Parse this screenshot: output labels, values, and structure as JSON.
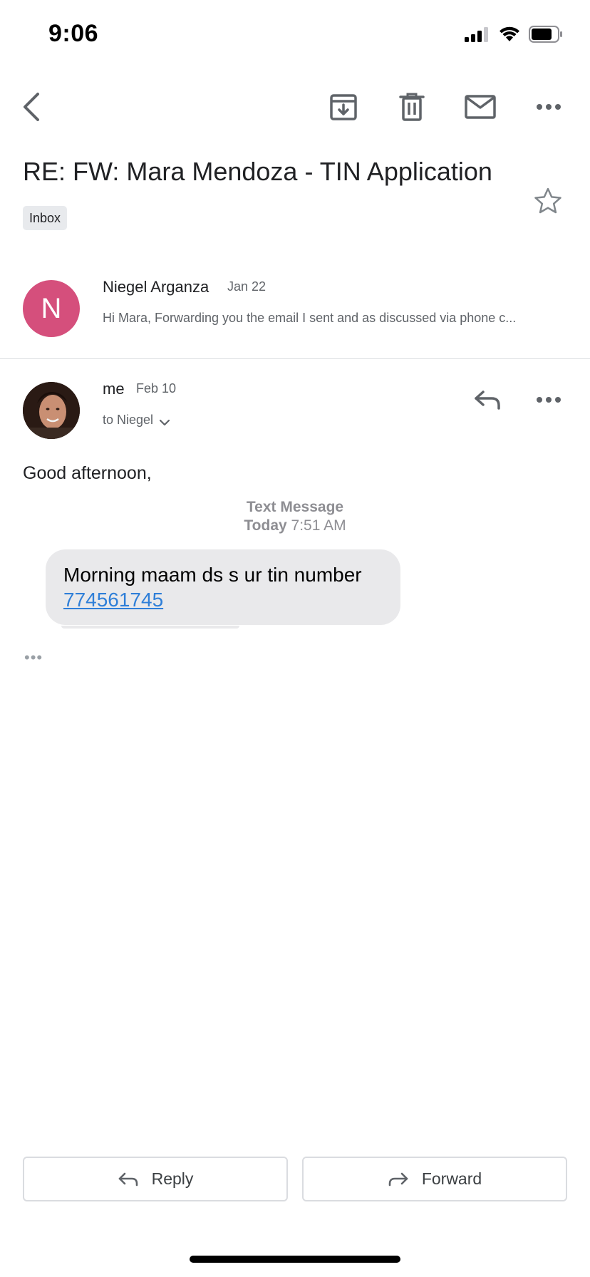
{
  "status_bar": {
    "time": "9:06"
  },
  "toolbar": {
    "back_icon": "chevron-left-icon",
    "archive_icon": "archive-icon",
    "delete_icon": "trash-icon",
    "mark_unread_icon": "mail-icon",
    "more_icon": "more-horizontal-icon"
  },
  "email": {
    "subject": "RE: FW: Mara Mendoza - TIN Application",
    "label": "Inbox"
  },
  "messages": [
    {
      "avatar_letter": "N",
      "avatar_color": "#d54f7c",
      "sender": "Niegel Arganza",
      "date": "Jan 22",
      "snippet": "Hi Mara, Forwarding you the email I sent and as discussed via phone c..."
    },
    {
      "sender": "me",
      "date": "Feb 10",
      "recipient": "to Niegel",
      "greeting": "Good afternoon,",
      "sms": {
        "header_line1": "Text Message",
        "header_day": "Today",
        "header_time": "7:51 AM",
        "text": "Morning maam ds s ur tin number",
        "number": "774561745"
      },
      "trimmed_content": "•••"
    }
  ],
  "footer": {
    "reply_label": "Reply",
    "forward_label": "Forward"
  },
  "colors": {
    "link": "#2f7fd8",
    "bubble": "#e9e9eb",
    "divider": "#dadce0"
  }
}
